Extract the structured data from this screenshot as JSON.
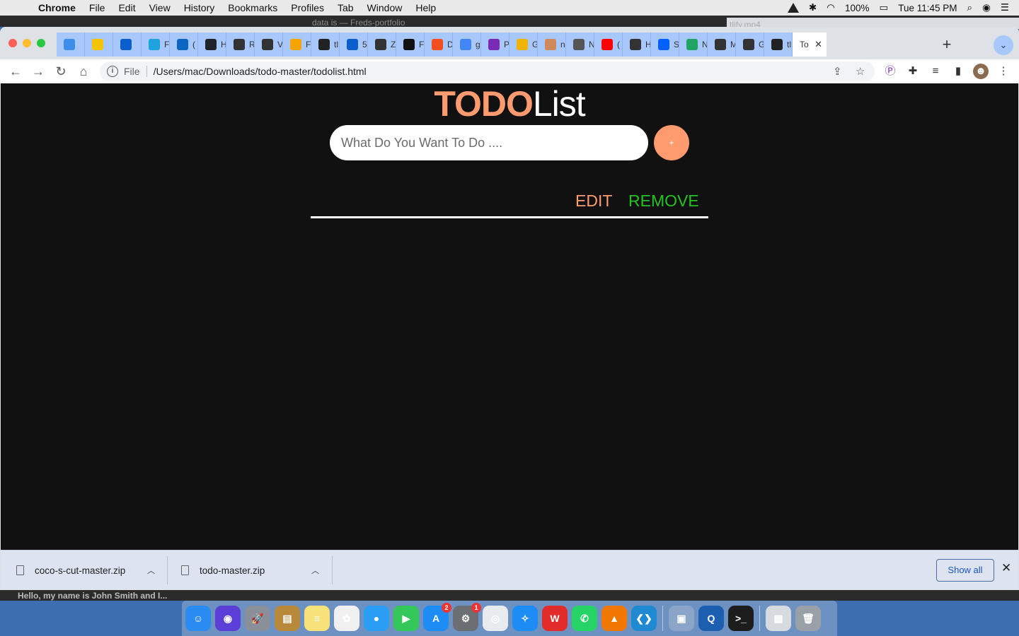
{
  "menubar": {
    "app_name": "Chrome",
    "items": [
      "File",
      "Edit",
      "View",
      "History",
      "Bookmarks",
      "Profiles",
      "Tab",
      "Window",
      "Help"
    ],
    "battery": "100%",
    "clock": "Tue 11:45 PM"
  },
  "background_window": {
    "title": "data is — Freds-portfolio",
    "right_title": "tlify.mp4"
  },
  "tabs": [
    {
      "label": "",
      "icon": "vscode-icon",
      "color": "#3b8eea"
    },
    {
      "label": "",
      "icon": "mtn-icon",
      "color": "#f5c400"
    },
    {
      "label": "",
      "icon": "tm-icon",
      "color": "#0a5fcc"
    },
    {
      "label": "F",
      "icon": "diamond-icon",
      "color": "#1fa3e0"
    },
    {
      "label": "(",
      "icon": "linkedin-icon",
      "color": "#0a66c2"
    },
    {
      "label": "H",
      "icon": "react-icon",
      "color": "#20232a"
    },
    {
      "label": "R",
      "icon": "globe-icon",
      "color": "#333333"
    },
    {
      "label": "V",
      "icon": "globe-icon",
      "color": "#333333"
    },
    {
      "label": "F",
      "icon": "firebase-icon",
      "color": "#f6a500"
    },
    {
      "label": "tl",
      "icon": "github-icon",
      "color": "#222222"
    },
    {
      "label": "5",
      "icon": "tm-icon",
      "color": "#0a5fcc"
    },
    {
      "label": "Z",
      "icon": "globe-icon",
      "color": "#333333"
    },
    {
      "label": "F",
      "icon": "square-icon",
      "color": "#111111"
    },
    {
      "label": "D",
      "icon": "figma-icon",
      "color": "#f24e1e"
    },
    {
      "label": "g",
      "icon": "google-icon",
      "color": "#4285f4"
    },
    {
      "label": "P",
      "icon": "purple-icon",
      "color": "#7b2ab8"
    },
    {
      "label": "G",
      "icon": "bolt-icon",
      "color": "#f0b400"
    },
    {
      "label": "n",
      "icon": "hand-icon",
      "color": "#d08a5a"
    },
    {
      "label": "N",
      "icon": "globe-icon",
      "color": "#555555"
    },
    {
      "label": "(",
      "icon": "youtube-icon",
      "color": "#ff0000"
    },
    {
      "label": "H",
      "icon": "hashnode-icon",
      "color": "#333333"
    },
    {
      "label": "S",
      "icon": "dropbox-icon",
      "color": "#0061fe"
    },
    {
      "label": "N",
      "icon": "drive-icon",
      "color": "#1fa463"
    },
    {
      "label": "M",
      "icon": "globe-icon",
      "color": "#333333"
    },
    {
      "label": "G",
      "icon": "globe-icon",
      "color": "#333333"
    },
    {
      "label": "tl",
      "icon": "github-icon",
      "color": "#222222"
    }
  ],
  "active_tab": {
    "label": "To",
    "close": "✕"
  },
  "new_tab_label": "+",
  "address": {
    "scheme": "File",
    "url": "/Users/mac/Downloads/todo-master/todolist.html"
  },
  "page": {
    "title_bold": "TODO",
    "title_rest": "List",
    "input_placeholder": "What Do You Want To Do ....",
    "add_label": "+",
    "edit_label": "EDIT",
    "remove_label": "REMOVE",
    "colors": {
      "accent": "#ff9b6f",
      "remove": "#22c322",
      "background": "#111111"
    }
  },
  "downloads": {
    "files": [
      "coco-s-cut-master.zip",
      "todo-master.zip"
    ],
    "show_all": "Show all",
    "close": "✕"
  },
  "status_text": "Hello, my name is John Smith and I...",
  "dock": {
    "apps": [
      {
        "name": "finder-icon",
        "color": "#2a8cf0",
        "glyph": "☺"
      },
      {
        "name": "siri-icon",
        "color": "#5b3fd6",
        "glyph": "◉"
      },
      {
        "name": "launchpad-icon",
        "color": "#8a8f99",
        "glyph": "🚀"
      },
      {
        "name": "notefile-icon",
        "color": "#b8893a",
        "glyph": "▤"
      },
      {
        "name": "notes-icon",
        "color": "#f7e27a",
        "glyph": "≡"
      },
      {
        "name": "photos-icon",
        "color": "#f0f0f0",
        "glyph": "✿"
      },
      {
        "name": "messages-icon",
        "color": "#2a9df4",
        "glyph": "●"
      },
      {
        "name": "facetime-icon",
        "color": "#34c759",
        "glyph": "▶"
      },
      {
        "name": "appstore-icon",
        "color": "#1e8cf5",
        "glyph": "A",
        "badge": "2"
      },
      {
        "name": "system-preferences-icon",
        "color": "#6b6e73",
        "glyph": "⚙",
        "badge": "1"
      },
      {
        "name": "chrome-icon",
        "color": "#e8eaed",
        "glyph": "◎"
      },
      {
        "name": "safari-icon",
        "color": "#1e8cf5",
        "glyph": "✧"
      },
      {
        "name": "wps-icon",
        "color": "#e22b2b",
        "glyph": "W"
      },
      {
        "name": "whatsapp-icon",
        "color": "#25d366",
        "glyph": "✆"
      },
      {
        "name": "vlc-icon",
        "color": "#f07800",
        "glyph": "▲"
      },
      {
        "name": "vscode-icon",
        "color": "#1f8ad2",
        "glyph": "❮❯"
      }
    ],
    "apps_right": [
      {
        "name": "preview-icon",
        "color": "#8aa5c8",
        "glyph": "▣"
      },
      {
        "name": "quicktime-icon",
        "color": "#1c5fb0",
        "glyph": "Q"
      },
      {
        "name": "terminal-icon",
        "color": "#1d1d1d",
        "glyph": ">_"
      }
    ],
    "apps_end": [
      {
        "name": "downloads-stack-icon",
        "color": "#d7dbe0",
        "glyph": "▦"
      },
      {
        "name": "trash-icon",
        "color": "#9aa0a8",
        "glyph": "🗑"
      }
    ]
  }
}
